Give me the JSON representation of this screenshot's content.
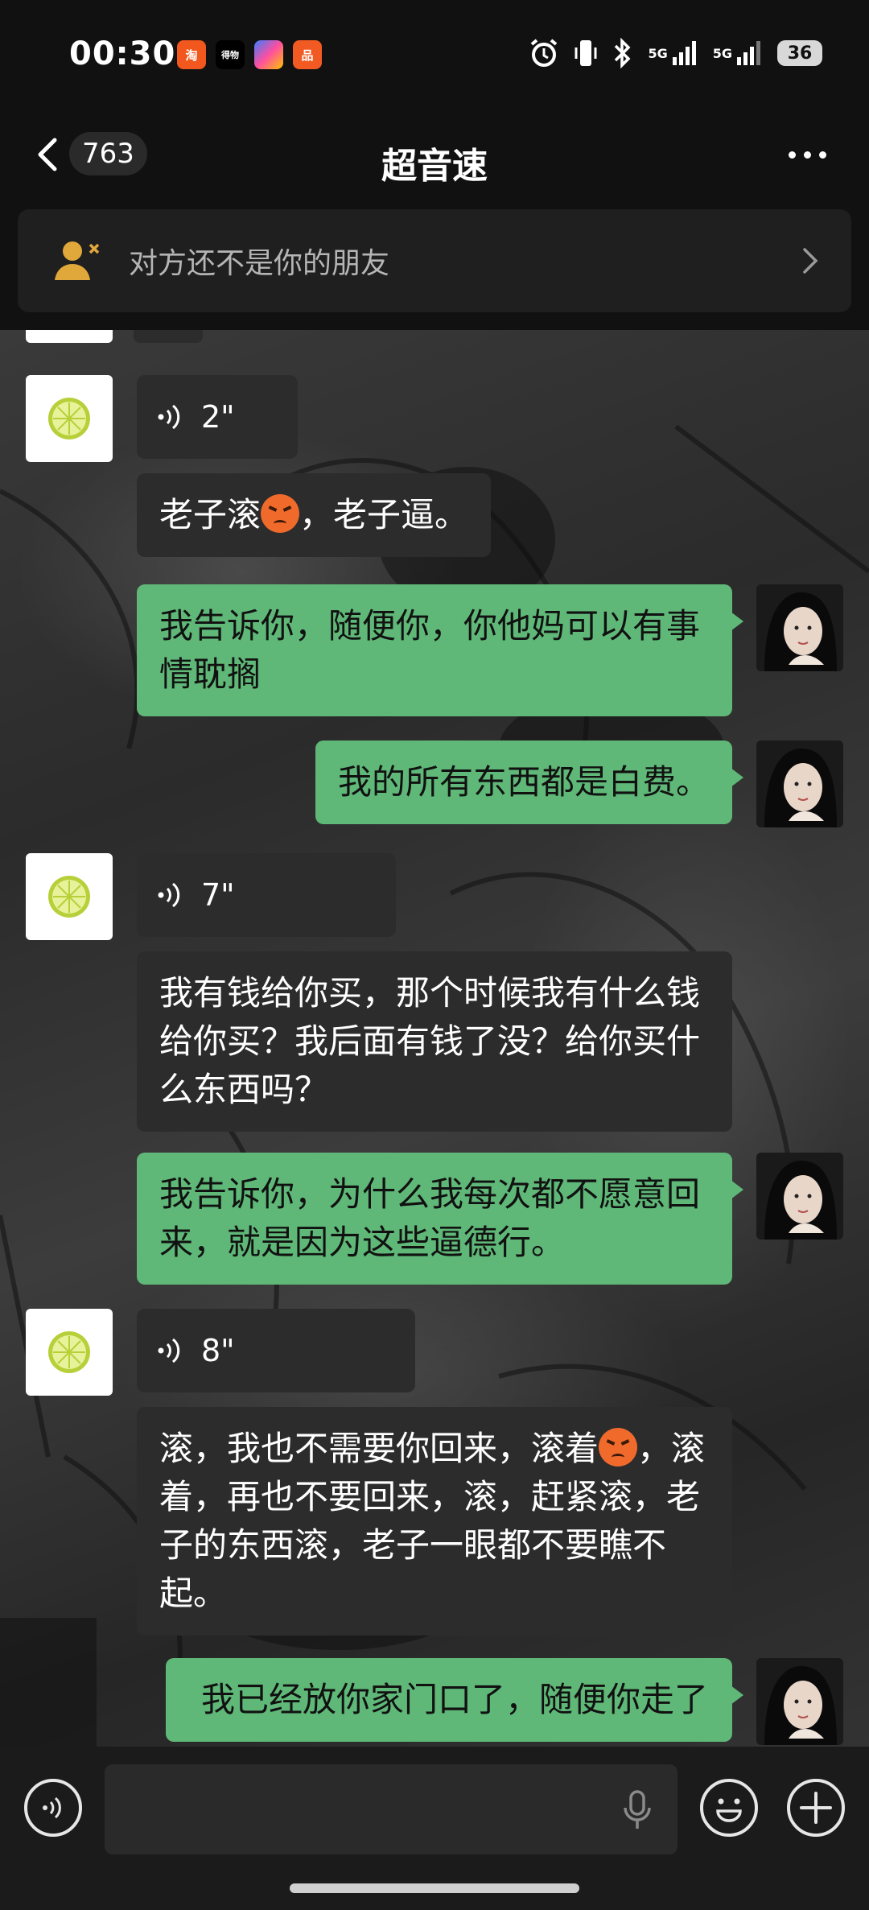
{
  "status_bar": {
    "time": "00:30",
    "app_icons": [
      "淘",
      "得物",
      "",
      "品"
    ],
    "network_1": "5G",
    "network_2": "5G",
    "battery": "36"
  },
  "nav": {
    "unread_count": "763",
    "title": "超音速"
  },
  "friend_banner": {
    "text": "对方还不是你的朋友"
  },
  "messages": [
    {
      "side": "in",
      "type": "voice",
      "duration": "2\""
    },
    {
      "side": "in",
      "type": "text",
      "text_before": "老子滚",
      "text_after": "，老子逼。"
    },
    {
      "side": "out",
      "type": "text",
      "text": "我告诉你，随便你，你他妈可以有事情耽搁"
    },
    {
      "side": "out",
      "type": "text",
      "text": "我的所有东西都是白费。"
    },
    {
      "side": "in",
      "type": "voice",
      "duration": "7\""
    },
    {
      "side": "in",
      "type": "text",
      "text": "我有钱给你买，那个时候我有什么钱给你买？我后面有钱了没？给你买什么东西吗？"
    },
    {
      "side": "out",
      "type": "text",
      "text": "我告诉你，为什么我每次都不愿意回来，就是因为这些逼德行。"
    },
    {
      "side": "in",
      "type": "voice",
      "duration": "8\""
    },
    {
      "side": "in",
      "type": "text",
      "text_before": "滚，我也不需要你回来，滚着",
      "text_after": "，滚着，再也不要回来，滚，赶紧滚，老子的东西滚，老子一眼都不要瞧不起。"
    },
    {
      "side": "out",
      "type": "text",
      "text": "我已经放你家门口了，随便你走了"
    }
  ],
  "colors": {
    "outgoing_bubble": "#5fb878",
    "incoming_bubble": "#2c2c2c",
    "background": "#111111"
  }
}
